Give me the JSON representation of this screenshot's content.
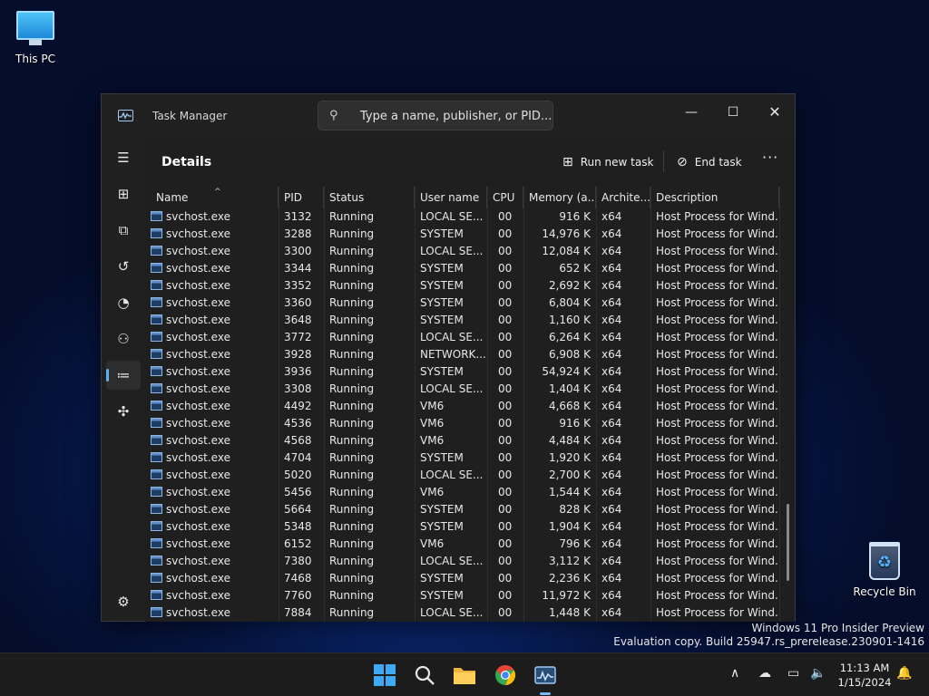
{
  "desktop": {
    "this_pc_label": "This PC",
    "recycle_bin_label": "Recycle Bin",
    "watermark_line1": "Windows 11 Pro Insider Preview",
    "watermark_line2": "Evaluation copy. Build 25947.rs_prerelease.230901-1416"
  },
  "window": {
    "title": "Task Manager",
    "search_placeholder": "Type a name, publisher, or PID...",
    "page_title": "Details",
    "run_new_task": "Run new task",
    "end_task": "End task",
    "more": "···"
  },
  "sidebar": [
    "hamburger-icon",
    "processes-icon",
    "performance-icon",
    "app-history-icon",
    "startup-apps-icon",
    "users-icon",
    "details-icon",
    "services-icon",
    "settings-icon"
  ],
  "columns": [
    "Name",
    "PID",
    "Status",
    "User name",
    "CPU",
    "Memory (a...",
    "Archite...",
    "Description"
  ],
  "rows": [
    {
      "name": "svchost.exe",
      "pid": "3132",
      "status": "Running",
      "user": "LOCAL SE...",
      "cpu": "00",
      "mem": "916 K",
      "arch": "x64",
      "desc": "Host Process for Wind..."
    },
    {
      "name": "svchost.exe",
      "pid": "3288",
      "status": "Running",
      "user": "SYSTEM",
      "cpu": "00",
      "mem": "14,976 K",
      "arch": "x64",
      "desc": "Host Process for Wind..."
    },
    {
      "name": "svchost.exe",
      "pid": "3300",
      "status": "Running",
      "user": "LOCAL SE...",
      "cpu": "00",
      "mem": "12,084 K",
      "arch": "x64",
      "desc": "Host Process for Wind..."
    },
    {
      "name": "svchost.exe",
      "pid": "3344",
      "status": "Running",
      "user": "SYSTEM",
      "cpu": "00",
      "mem": "652 K",
      "arch": "x64",
      "desc": "Host Process for Wind..."
    },
    {
      "name": "svchost.exe",
      "pid": "3352",
      "status": "Running",
      "user": "SYSTEM",
      "cpu": "00",
      "mem": "2,692 K",
      "arch": "x64",
      "desc": "Host Process for Wind..."
    },
    {
      "name": "svchost.exe",
      "pid": "3360",
      "status": "Running",
      "user": "SYSTEM",
      "cpu": "00",
      "mem": "6,804 K",
      "arch": "x64",
      "desc": "Host Process for Wind..."
    },
    {
      "name": "svchost.exe",
      "pid": "3648",
      "status": "Running",
      "user": "SYSTEM",
      "cpu": "00",
      "mem": "1,160 K",
      "arch": "x64",
      "desc": "Host Process for Wind..."
    },
    {
      "name": "svchost.exe",
      "pid": "3772",
      "status": "Running",
      "user": "LOCAL SE...",
      "cpu": "00",
      "mem": "6,264 K",
      "arch": "x64",
      "desc": "Host Process for Wind..."
    },
    {
      "name": "svchost.exe",
      "pid": "3928",
      "status": "Running",
      "user": "NETWORK...",
      "cpu": "00",
      "mem": "6,908 K",
      "arch": "x64",
      "desc": "Host Process for Wind..."
    },
    {
      "name": "svchost.exe",
      "pid": "3936",
      "status": "Running",
      "user": "SYSTEM",
      "cpu": "00",
      "mem": "54,924 K",
      "arch": "x64",
      "desc": "Host Process for Wind..."
    },
    {
      "name": "svchost.exe",
      "pid": "3308",
      "status": "Running",
      "user": "LOCAL SE...",
      "cpu": "00",
      "mem": "1,404 K",
      "arch": "x64",
      "desc": "Host Process for Wind..."
    },
    {
      "name": "svchost.exe",
      "pid": "4492",
      "status": "Running",
      "user": "VM6",
      "cpu": "00",
      "mem": "4,668 K",
      "arch": "x64",
      "desc": "Host Process for Wind..."
    },
    {
      "name": "svchost.exe",
      "pid": "4536",
      "status": "Running",
      "user": "VM6",
      "cpu": "00",
      "mem": "916 K",
      "arch": "x64",
      "desc": "Host Process for Wind..."
    },
    {
      "name": "svchost.exe",
      "pid": "4568",
      "status": "Running",
      "user": "VM6",
      "cpu": "00",
      "mem": "4,484 K",
      "arch": "x64",
      "desc": "Host Process for Wind..."
    },
    {
      "name": "svchost.exe",
      "pid": "4704",
      "status": "Running",
      "user": "SYSTEM",
      "cpu": "00",
      "mem": "1,920 K",
      "arch": "x64",
      "desc": "Host Process for Wind..."
    },
    {
      "name": "svchost.exe",
      "pid": "5020",
      "status": "Running",
      "user": "LOCAL SE...",
      "cpu": "00",
      "mem": "2,700 K",
      "arch": "x64",
      "desc": "Host Process for Wind..."
    },
    {
      "name": "svchost.exe",
      "pid": "5456",
      "status": "Running",
      "user": "VM6",
      "cpu": "00",
      "mem": "1,544 K",
      "arch": "x64",
      "desc": "Host Process for Wind..."
    },
    {
      "name": "svchost.exe",
      "pid": "5664",
      "status": "Running",
      "user": "SYSTEM",
      "cpu": "00",
      "mem": "828 K",
      "arch": "x64",
      "desc": "Host Process for Wind..."
    },
    {
      "name": "svchost.exe",
      "pid": "5348",
      "status": "Running",
      "user": "SYSTEM",
      "cpu": "00",
      "mem": "1,904 K",
      "arch": "x64",
      "desc": "Host Process for Wind..."
    },
    {
      "name": "svchost.exe",
      "pid": "6152",
      "status": "Running",
      "user": "VM6",
      "cpu": "00",
      "mem": "796 K",
      "arch": "x64",
      "desc": "Host Process for Wind..."
    },
    {
      "name": "svchost.exe",
      "pid": "7380",
      "status": "Running",
      "user": "LOCAL SE...",
      "cpu": "00",
      "mem": "3,112 K",
      "arch": "x64",
      "desc": "Host Process for Wind..."
    },
    {
      "name": "svchost.exe",
      "pid": "7468",
      "status": "Running",
      "user": "SYSTEM",
      "cpu": "00",
      "mem": "2,236 K",
      "arch": "x64",
      "desc": "Host Process for Wind..."
    },
    {
      "name": "svchost.exe",
      "pid": "7760",
      "status": "Running",
      "user": "SYSTEM",
      "cpu": "00",
      "mem": "11,972 K",
      "arch": "x64",
      "desc": "Host Process for Wind..."
    },
    {
      "name": "svchost.exe",
      "pid": "7884",
      "status": "Running",
      "user": "LOCAL SE...",
      "cpu": "00",
      "mem": "1,448 K",
      "arch": "x64",
      "desc": "Host Process for Wind..."
    }
  ],
  "taskbar": {
    "time": "11:13 AM",
    "date": "1/15/2024"
  },
  "colors": {
    "accent": "#5ab0f5",
    "window_bg": "#202020",
    "taskbar_bg": "#1c1c1c"
  }
}
